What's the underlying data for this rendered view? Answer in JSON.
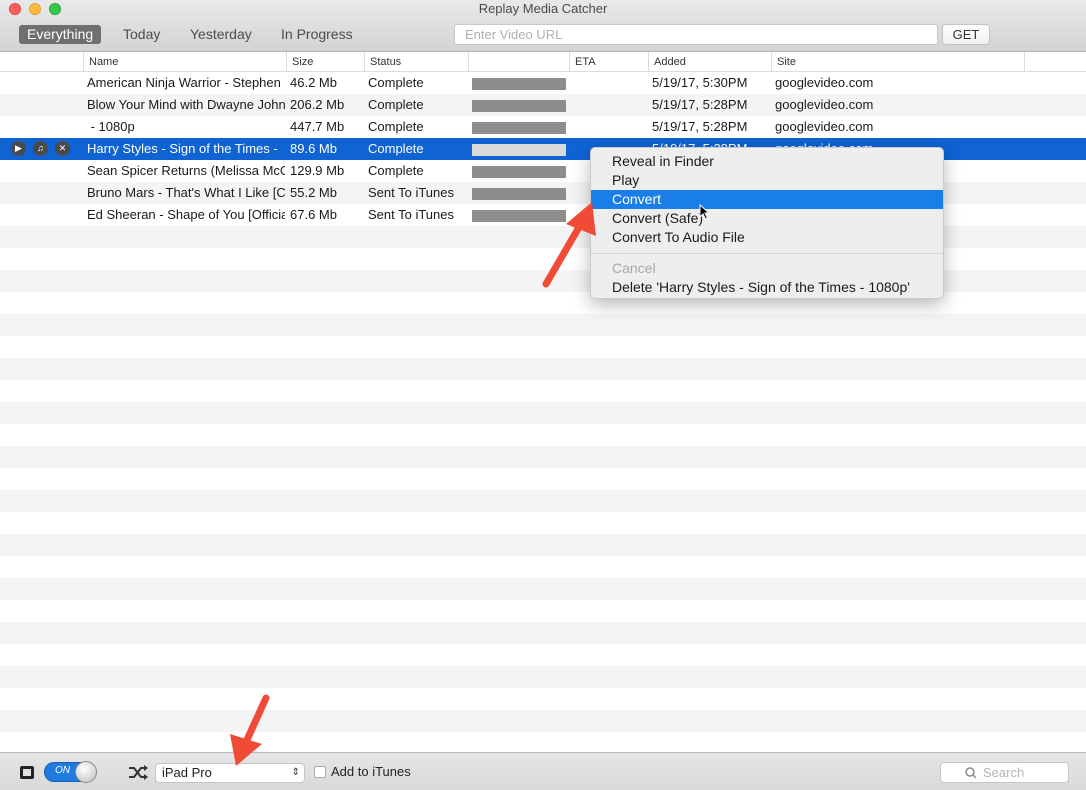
{
  "window": {
    "title": "Replay Media Catcher"
  },
  "filters": {
    "tabs": [
      "Everything",
      "Today",
      "Yesterday",
      "In Progress"
    ],
    "active": "Everything"
  },
  "url_bar": {
    "placeholder": "Enter Video URL",
    "value": "",
    "get_label": "GET"
  },
  "table": {
    "columns": {
      "name": "Name",
      "size": "Size",
      "status": "Status",
      "progress": "",
      "eta": "ETA",
      "added": "Added",
      "site": "Site"
    },
    "rows": [
      {
        "name": "American Ninja Warrior - Stephen",
        "size": "46.2 Mb",
        "status": "Complete",
        "progress_pct": 100,
        "eta": "",
        "added": "5/19/17, 5:30PM",
        "site": "googlevideo.com",
        "selected": false
      },
      {
        "name": "Blow Your Mind with Dwayne John",
        "size": "206.2 Mb",
        "status": "Complete",
        "progress_pct": 100,
        "eta": "",
        "added": "5/19/17, 5:28PM",
        "site": "googlevideo.com",
        "selected": false
      },
      {
        "name": " - 1080p",
        "size": "447.7 Mb",
        "status": "Complete",
        "progress_pct": 100,
        "eta": "",
        "added": "5/19/17, 5:28PM",
        "site": "googlevideo.com",
        "selected": false
      },
      {
        "name": "Harry Styles - Sign of the Times -",
        "size": "89.6 Mb",
        "status": "Complete",
        "progress_pct": 100,
        "eta": "",
        "added": "5/19/17, 5:28PM",
        "site": "googlevideo.com",
        "selected": true
      },
      {
        "name": "Sean Spicer Returns (Melissa McCa",
        "size": "129.9 Mb",
        "status": "Complete",
        "progress_pct": 100,
        "eta": "",
        "added": "",
        "site": "",
        "selected": false
      },
      {
        "name": "Bruno Mars - That's What I Like [C",
        "size": "55.2 Mb",
        "status": "Sent To iTunes",
        "progress_pct": 100,
        "eta": "",
        "added": "",
        "site": "",
        "selected": false
      },
      {
        "name": "Ed Sheeran - Shape of You [Officia",
        "size": "67.6 Mb",
        "status": "Sent To iTunes",
        "progress_pct": 100,
        "eta": "",
        "added": "",
        "site": "",
        "selected": false
      }
    ],
    "row_actions": [
      "play-icon",
      "music-note-icon",
      "close-icon"
    ]
  },
  "context_menu": {
    "items": [
      {
        "label": "Reveal in Finder",
        "state": "normal"
      },
      {
        "label": "Play",
        "state": "normal"
      },
      {
        "label": "Convert",
        "state": "highlighted"
      },
      {
        "label": "Convert (Safe)",
        "state": "normal"
      },
      {
        "label": "Convert To Audio File",
        "state": "normal"
      }
    ],
    "secondary_items": [
      {
        "label": "Cancel",
        "state": "disabled"
      },
      {
        "label": "Delete 'Harry Styles - Sign of the Times - 1080p'",
        "state": "normal"
      }
    ]
  },
  "bottom_bar": {
    "toggle_label": "ON",
    "toggle_on": true,
    "device_selected": "iPad Pro",
    "add_to_itunes_label": "Add to iTunes",
    "add_to_itunes_checked": false,
    "search_placeholder": "Search"
  },
  "colors": {
    "selection": "#0f63d2",
    "menu_highlight": "#1a7ee8",
    "annotation_arrow": "#f04b37"
  }
}
